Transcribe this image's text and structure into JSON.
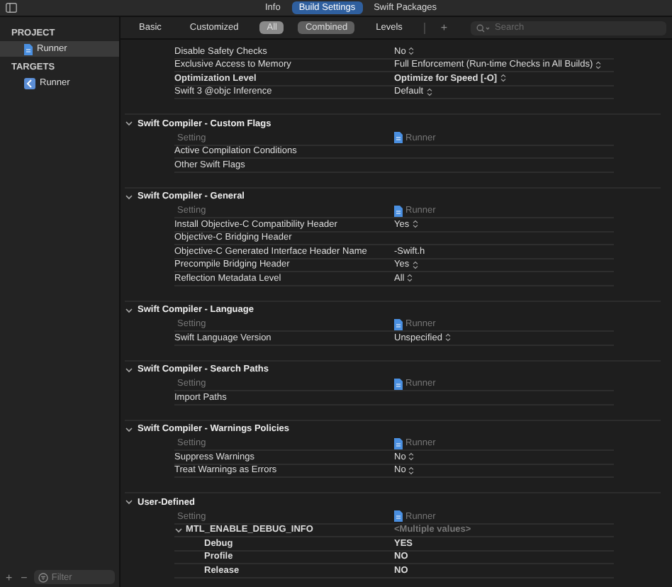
{
  "toolbar": {
    "tabs": [
      {
        "label": "Info",
        "selected": false
      },
      {
        "label": "Build Settings",
        "selected": true
      },
      {
        "label": "Swift Packages",
        "selected": false
      }
    ]
  },
  "filter_bar": {
    "scopes": [
      {
        "label": "Basic",
        "selected": false
      },
      {
        "label": "Customized",
        "selected": false
      },
      {
        "label": "All",
        "selected": true
      }
    ],
    "modes": [
      {
        "label": "Combined",
        "selected": true
      },
      {
        "label": "Levels",
        "selected": false
      }
    ],
    "add": "+",
    "search": {
      "placeholder": "Search"
    }
  },
  "sidebar": {
    "groups": [
      {
        "title": "PROJECT",
        "items": [
          {
            "label": "Runner",
            "kind": "project",
            "selected": true
          }
        ]
      },
      {
        "title": "TARGETS",
        "items": [
          {
            "label": "Runner",
            "kind": "target",
            "selected": false
          }
        ]
      }
    ],
    "buttons": [
      "+",
      "−"
    ],
    "filter": {
      "placeholder": "Filter"
    }
  },
  "sections": [
    {
      "rows": [
        {
          "name": "Disable Safety Checks",
          "value": "No",
          "bold": false,
          "popup": true
        },
        {
          "name": "Exclusive Access to Memory",
          "value": "Full Enforcement (Run-time Checks in All Builds)",
          "bold": false,
          "popup": true
        },
        {
          "name": "Optimization Level",
          "value": "Optimize for Speed [-O]",
          "bold": true,
          "popup": true
        },
        {
          "name": "Swift 3 @objc Inference",
          "value": "Default",
          "bold": false,
          "popup": true
        }
      ]
    },
    {
      "title": "Swift Compiler - Custom Flags",
      "expanded": true,
      "header": {
        "setting": "Setting",
        "target": "Runner"
      },
      "rows": [
        {
          "name": "Active Compilation Conditions",
          "bold": false
        },
        {
          "name": "Other Swift Flags",
          "bold": false
        }
      ]
    },
    {
      "title": "Swift Compiler - General",
      "expanded": true,
      "header": {
        "setting": "Setting",
        "target": "Runner"
      },
      "rows": [
        {
          "name": "Install Objective-C Compatibility Header",
          "value": "Yes",
          "bold": false,
          "popup": true
        },
        {
          "name": "Objective-C Bridging Header",
          "bold": false
        },
        {
          "name": "Objective-C Generated Interface Header Name",
          "value": "-Swift.h",
          "bold": false,
          "popup": false
        },
        {
          "name": "Precompile Bridging Header",
          "value": "Yes",
          "bold": false,
          "popup": true
        },
        {
          "name": "Reflection Metadata Level",
          "value": "All",
          "bold": false,
          "popup": true
        }
      ]
    },
    {
      "title": "Swift Compiler - Language",
      "expanded": true,
      "header": {
        "setting": "Setting",
        "target": "Runner"
      },
      "rows": [
        {
          "name": "Swift Language Version",
          "value": "Unspecified",
          "bold": false,
          "popup": true
        }
      ]
    },
    {
      "title": "Swift Compiler - Search Paths",
      "expanded": true,
      "header": {
        "setting": "Setting",
        "target": "Runner"
      },
      "rows": [
        {
          "name": "Import Paths",
          "bold": false
        }
      ]
    },
    {
      "title": "Swift Compiler - Warnings Policies",
      "expanded": true,
      "header": {
        "setting": "Setting",
        "target": "Runner"
      },
      "rows": [
        {
          "name": "Suppress Warnings",
          "value": "No",
          "bold": false,
          "popup": true
        },
        {
          "name": "Treat Warnings as Errors",
          "value": "No",
          "bold": false,
          "popup": true
        }
      ]
    },
    {
      "title": "User-Defined",
      "expanded": true,
      "header": {
        "setting": "Setting",
        "target": "Runner"
      },
      "rows": [
        {
          "name": "MTL_ENABLE_DEBUG_INFO",
          "value": "<Multiple values>",
          "bold": true,
          "popup": false,
          "expanded": true,
          "children": [
            {
              "name": "Debug",
              "value": "YES",
              "bold": true,
              "popup": false
            },
            {
              "name": "Profile",
              "value": "NO",
              "bold": true,
              "popup": false
            },
            {
              "name": "Release",
              "value": "NO",
              "bold": true,
              "popup": false
            }
          ]
        }
      ]
    }
  ]
}
